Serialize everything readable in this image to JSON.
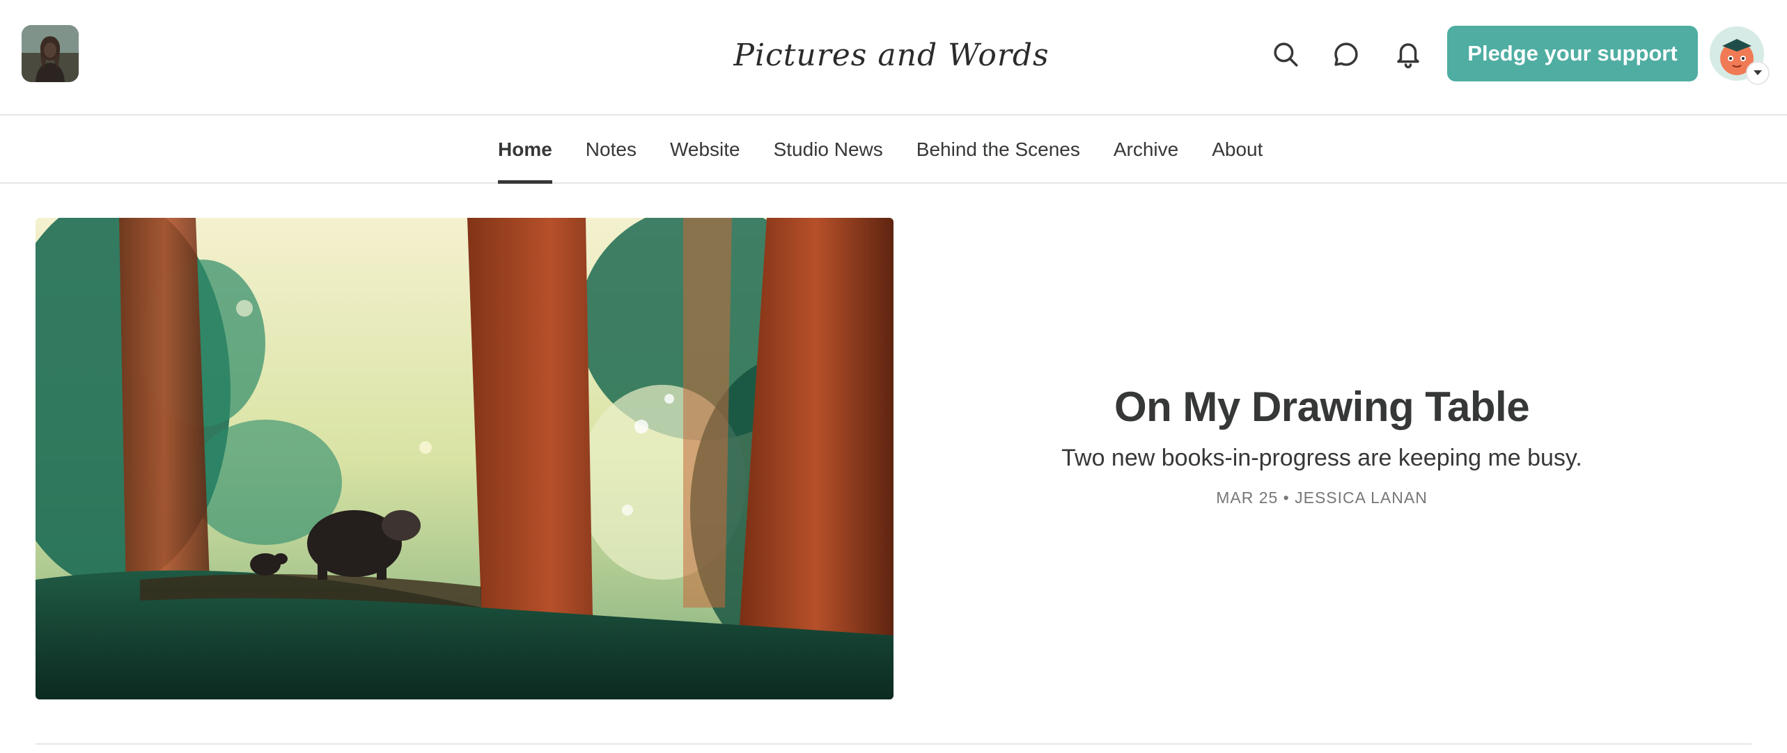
{
  "header": {
    "logo_text": "Pictures and Words",
    "pledge_label": "Pledge your support",
    "accent_color": "#4fada2",
    "icons": [
      "search-icon",
      "chat-icon",
      "bell-icon"
    ]
  },
  "nav": {
    "items": [
      {
        "label": "Home",
        "active": true
      },
      {
        "label": "Notes"
      },
      {
        "label": "Website"
      },
      {
        "label": "Studio News"
      },
      {
        "label": "Behind the Scenes"
      },
      {
        "label": "Archive"
      },
      {
        "label": "About"
      }
    ]
  },
  "post": {
    "title": "On My Drawing Table",
    "subtitle": "Two new books-in-progress are keeping me busy.",
    "date": "MAR 25",
    "separator": "•",
    "author": "JESSICA LANAN"
  }
}
